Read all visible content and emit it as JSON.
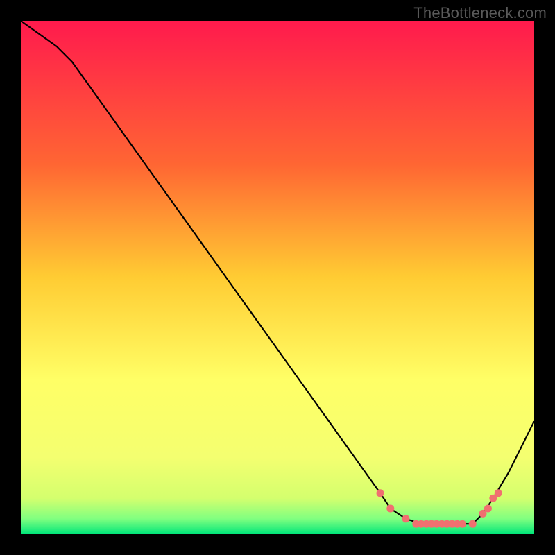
{
  "watermark": "TheBottleneck.com",
  "colors": {
    "background": "#000000",
    "watermark_text": "#5a5a5a",
    "line": "#000000",
    "marker": "#f07070",
    "gradient_top": "#ff1a4d",
    "gradient_mid1": "#ff9933",
    "gradient_mid2": "#ffff66",
    "gradient_low": "#e8ff66",
    "gradient_bottom": "#00e67a"
  },
  "chart_data": {
    "type": "line",
    "title": "",
    "xlabel": "",
    "ylabel": "",
    "xlim": [
      0,
      100
    ],
    "ylim": [
      0,
      100
    ],
    "series": [
      {
        "name": "curve",
        "x": [
          0,
          7,
          10,
          15,
          20,
          25,
          30,
          35,
          40,
          45,
          50,
          55,
          60,
          65,
          70,
          72,
          75,
          78,
          80,
          83,
          85,
          88,
          90,
          92,
          95,
          100
        ],
        "values": [
          100,
          95,
          92,
          85,
          78,
          71,
          64,
          57,
          50,
          43,
          36,
          29,
          22,
          15,
          8,
          5,
          3,
          2,
          2,
          2,
          2,
          2,
          4,
          7,
          12,
          22
        ]
      }
    ],
    "markers": {
      "name": "highlight-points",
      "x": [
        70,
        72,
        75,
        77,
        78,
        79,
        80,
        81,
        82,
        83,
        84,
        85,
        86,
        88,
        90,
        91,
        92,
        93
      ],
      "values": [
        8,
        5,
        3,
        2,
        2,
        2,
        2,
        2,
        2,
        2,
        2,
        2,
        2,
        2,
        4,
        5,
        7,
        8
      ]
    }
  }
}
